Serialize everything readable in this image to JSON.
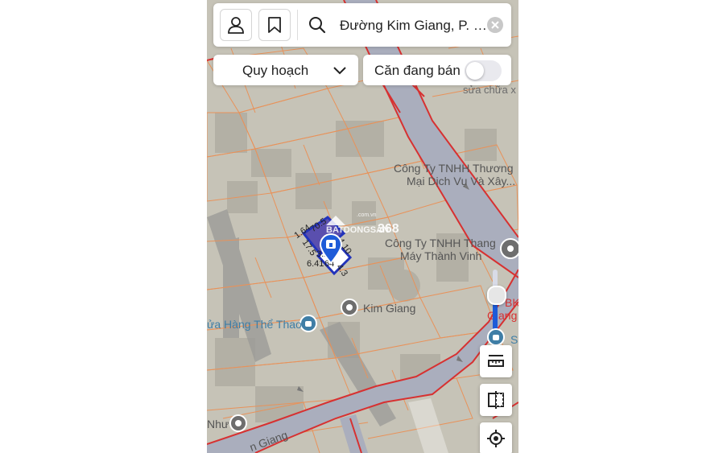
{
  "header": {
    "search_text": "Đường Kim Giang, P. Đại ...",
    "planning_dropdown_label": "Quy hoạch",
    "for_sale_label": "Căn đang bán",
    "for_sale_toggle_on": false
  },
  "map": {
    "labels": [
      {
        "id": "company-1-line1",
        "text": "Công Ty TNHH Thương"
      },
      {
        "id": "company-1-line2",
        "text": "Mại Dịch Vụ Và Xây..."
      },
      {
        "id": "company-2-line1",
        "text": "Công Ty TNHH Thang"
      },
      {
        "id": "company-2-line2",
        "text": "Máy Thành Vinh"
      },
      {
        "id": "kim-giang-poi",
        "text": "Kim Giang"
      },
      {
        "id": "sports-shop",
        "text": "ửa Hàng Thể Thao"
      },
      {
        "id": "street-bottom",
        "text": "n Giang"
      },
      {
        "id": "repair-top",
        "text": "sửa chữa x"
      },
      {
        "id": "bk-line1",
        "text": "BK"
      },
      {
        "id": "bk-line2",
        "text": "Giang"
      },
      {
        "id": "nhu-label",
        "text": "Như"
      },
      {
        "id": "s-label",
        "text": "S"
      }
    ],
    "parcel_dimensions": [
      "1.64",
      "70.5",
      "4.10",
      "17.5",
      "3.29",
      "6.41",
      "64",
      "4.3"
    ],
    "watermark": {
      "brand": "BATDONGSAN",
      "number": "368",
      "small": ".com.vn"
    },
    "colors": {
      "road": "#aaaebd",
      "road_border": "#d73131",
      "parcel_outline": "#e8925a",
      "selected_parcel": "#2233bb",
      "marker_blue": "#1e5bd8"
    }
  },
  "tools": {
    "measure_icon": "ruler-icon",
    "compare_icon": "split-view-icon",
    "locate_icon": "my-location-icon"
  }
}
